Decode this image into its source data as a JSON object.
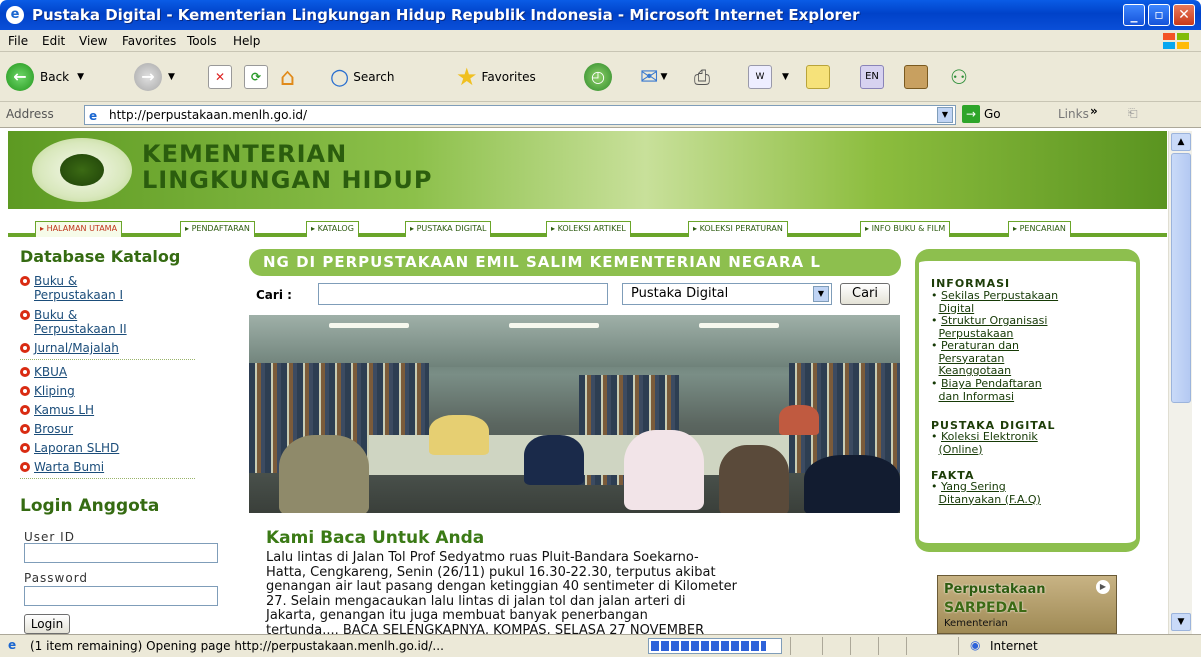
{
  "window": {
    "title": "Pustaka Digital - Kementerian Lingkungan Hidup Republik Indonesia - Microsoft Internet Explorer"
  },
  "menu": [
    "File",
    "Edit",
    "View",
    "Favorites",
    "Tools",
    "Help"
  ],
  "toolbar": {
    "back": "Back",
    "search": "Search",
    "favorites": "Favorites"
  },
  "address": {
    "label": "Address",
    "url": "http://perpustakaan.menlh.go.id/",
    "go": "Go",
    "links": "Links"
  },
  "site": {
    "header_line1": "KEMENTERIAN",
    "header_line2": "LINGKUNGAN HIDUP",
    "tabs": [
      "HALAMAN UTAMA",
      "PENDAFTARAN",
      "KATALOG",
      "PUSTAKA DIGITAL",
      "KOLEKSI ARTIKEL",
      "KOLEKSI PERATURAN",
      "INFO BUKU & FILM",
      "PENCARIAN"
    ],
    "catalog_heading": "Database Katalog",
    "catalog_items": [
      [
        "Buku &",
        "Perpustakaan I"
      ],
      [
        "Buku &",
        "Perpustakaan II"
      ],
      [
        "Jurnal/Majalah"
      ],
      [
        "KBUA"
      ],
      [
        "Kliping"
      ],
      [
        "Kamus LH"
      ],
      [
        "Brosur"
      ],
      [
        "Laporan SLHD"
      ],
      [
        "Warta Bumi"
      ]
    ],
    "login_heading": "Login Anggota",
    "userid_label": "User ID",
    "password_label": "Password",
    "login_button": "Login",
    "marquee": "NG DI PERPUSTAKAAN EMIL SALIM KEMENTERIAN NEGARA L",
    "search_label": "Cari :",
    "search_value": "",
    "search_select": "Pustaka Digital",
    "search_button": "Cari",
    "article_heading": "Kami Baca Untuk Anda",
    "article_lines": [
      "Lalu lintas di Jalan Tol Prof Sedyatmo ruas Pluit-Bandara Soekarno-",
      "Hatta, Cengkareng, Senin (26/11) pukul 16.30-22.30, terputus akibat",
      "genangan air laut pasang dengan ketinggian 40 sentimeter di Kilometer",
      "27. Selain mengacaukan lalu lintas di jalan tol dan jalan arteri di",
      "Jakarta, genangan itu juga membuat banyak penerbangan",
      "tertunda.... BACA SELENGKAPNYA, KOMPAS, SELASA 27 NOVEMBER"
    ],
    "info_heading": "INFORMASI",
    "info_links": [
      [
        "Sekilas Perpustakaan",
        "Digital"
      ],
      [
        "Struktur Organisasi",
        "Perpustakaan"
      ],
      [
        "Peraturan dan",
        "Persyaratan",
        "Keanggotaan"
      ],
      [
        "Biaya Pendaftaran",
        "dan Informasi"
      ]
    ],
    "pd_heading": "PUSTAKA DIGITAL",
    "pd_links": [
      [
        "Koleksi Elektronik",
        "(Online)"
      ]
    ],
    "fakta_heading": "FAKTA",
    "fakta_links": [
      [
        "Yang Sering",
        "Ditanyakan (F.A.Q)"
      ]
    ],
    "banner_line1": "Perpustakaan",
    "banner_line2": "SARPEDAL",
    "banner_line3": "Kementerian"
  },
  "status": {
    "text": "(1 item remaining) Opening page http://perpustakaan.menlh.go.id/...",
    "zone": "Internet",
    "progress": 0.9
  },
  "colors": {
    "xp_blue": "#0042c9",
    "site_green": "#6aa52a",
    "heading_green": "#356b12",
    "bullet_red": "#d92b12"
  }
}
